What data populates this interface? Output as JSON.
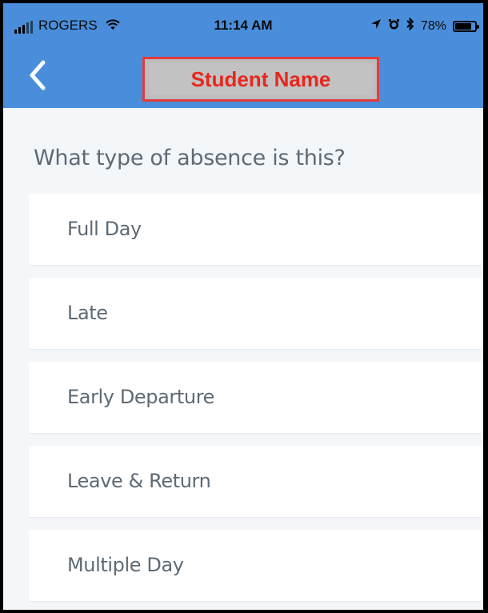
{
  "status_bar": {
    "carrier": "ROGERS",
    "time": "11:14 AM",
    "battery": "78%"
  },
  "header": {
    "title": "Student Name",
    "back_icon": "chevron-left-icon"
  },
  "question": "What type of absence is this?",
  "options": [
    {
      "label": "Full Day"
    },
    {
      "label": "Late"
    },
    {
      "label": "Early Departure"
    },
    {
      "label": "Leave & Return"
    },
    {
      "label": "Multiple Day"
    }
  ],
  "colors": {
    "header": "#4a8edb",
    "title_text": "#e5281f",
    "title_border": "#e33b3b",
    "title_bg": "#bdbdbd",
    "background": "#f4f7fa",
    "text": "#5e6a74"
  }
}
